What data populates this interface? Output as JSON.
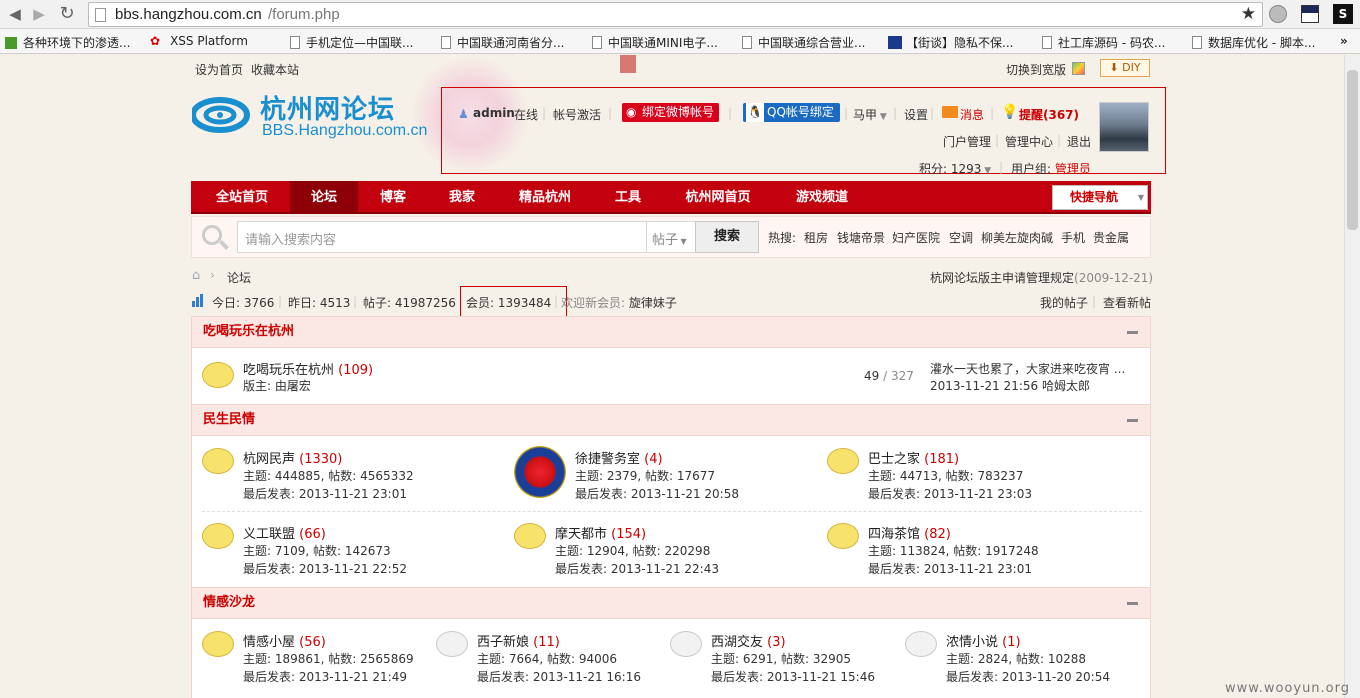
{
  "browser": {
    "url_host": "bbs.hangzhou.com.cn",
    "url_path": "/forum.php",
    "bookmarks": [
      "各种环境下的渗透...",
      "XSS Platform",
      "手机定位—中国联...",
      "中国联通河南省分...",
      "中国联通MINI电子...",
      "中国联通综合营业...",
      "【街谈】隐私不保...",
      "社工库源码 - 码农...",
      "数据库优化 - 脚本..."
    ],
    "more": "»"
  },
  "topbar": {
    "set_home": "设为首页",
    "bookmark_site": "收藏本站",
    "wide": "切换到宽版",
    "diy": "DIY"
  },
  "logo": {
    "cn": "杭州网论坛",
    "en": "BBS.Hangzhou.com.cn"
  },
  "user": {
    "name": "admin",
    "status": "在线",
    "activate": "帐号激活",
    "weibo": "绑定微博帐号",
    "qq": "QQ帐号绑定",
    "alt": "马甲",
    "settings": "设置",
    "messages": "消息",
    "reminders": "提醒(367)",
    "portal_admin": "门户管理",
    "admin_center": "管理中心",
    "logout": "退出",
    "points": "积分: 1293",
    "group_label": "用户组: ",
    "group": "管理员"
  },
  "nav": {
    "items": [
      "全站首页",
      "论坛",
      "博客",
      "我家",
      "精品杭州",
      "工具",
      "杭州网首页",
      "游戏频道"
    ],
    "quick": "快捷导航"
  },
  "search": {
    "placeholder": "请输入搜索内容",
    "type": "帖子",
    "button": "搜索",
    "hot_label": "热搜:",
    "hot": [
      "租房",
      "钱塘帝景",
      "妇产医院",
      "空调",
      "柳美左旋肉碱",
      "手机",
      "贵金属"
    ]
  },
  "breadcrumb": {
    "current": "论坛",
    "notice": "杭网论坛版主申请管理规定",
    "notice_date": "(2009-12-21)"
  },
  "stats": {
    "today": "今日: 3766",
    "yesterday": "昨日: 4513",
    "posts": "帖子: 41987256",
    "members": "会员: 1393484",
    "welcome": "欢迎新会员: ",
    "newest": "旋律妹子",
    "my_posts": "我的帖子",
    "new_posts": "查看新帖"
  },
  "sections": [
    {
      "title": "吃喝玩乐在杭州",
      "forums": [
        {
          "name": "吃喝玩乐在杭州",
          "count": "(109)",
          "moderator": "版主: 由屠宏",
          "ratio_a": "49",
          "ratio_b": "327",
          "last_title": "灌水一天也累了，大家进来吃夜宵 ...",
          "last_info": "2013-11-21 21:56 哈姆太郎"
        }
      ]
    },
    {
      "title": "民生民情",
      "forums": [
        {
          "name": "杭网民声",
          "count": "(1330)",
          "stats": "主题: 444885, 帖数: 4565332",
          "last": "最后发表: 2013-11-21 23:01"
        },
        {
          "name": "徐捷警务室",
          "count": "(4)",
          "stats": "主题: 2379, 帖数: 17677",
          "last": "最后发表: 2013-11-21 20:58"
        },
        {
          "name": "巴士之家",
          "count": "(181)",
          "stats": "主题: 44713, 帖数: 783237",
          "last": "最后发表: 2013-11-21 23:03"
        },
        {
          "name": "义工联盟",
          "count": "(66)",
          "stats": "主题: 7109, 帖数: 142673",
          "last": "最后发表: 2013-11-21 22:52"
        },
        {
          "name": "摩天都市",
          "count": "(154)",
          "stats": "主题: 12904, 帖数: 220298",
          "last": "最后发表: 2013-11-21 22:43"
        },
        {
          "name": "四海茶馆",
          "count": "(82)",
          "stats": "主题: 113824, 帖数: 1917248",
          "last": "最后发表: 2013-11-21 23:01"
        }
      ]
    },
    {
      "title": "情感沙龙",
      "forums": [
        {
          "name": "情感小屋",
          "count": "(56)",
          "stats": "主题: 189861, 帖数: 2565869",
          "last": "最后发表: 2013-11-21 21:49"
        },
        {
          "name": "西子新娘",
          "count": "(11)",
          "stats": "主题: 7664, 帖数: 94006",
          "last": "最后发表: 2013-11-21 16:16"
        },
        {
          "name": "西湖交友",
          "count": "(3)",
          "stats": "主题: 6291, 帖数: 32905",
          "last": "最后发表: 2013-11-21 15:46"
        },
        {
          "name": "浓情小说",
          "count": "(1)",
          "stats": "主题: 2824, 帖数: 10288",
          "last": "最后发表: 2013-11-20 20:54"
        }
      ]
    }
  ],
  "watermark": "www.wooyun.org"
}
